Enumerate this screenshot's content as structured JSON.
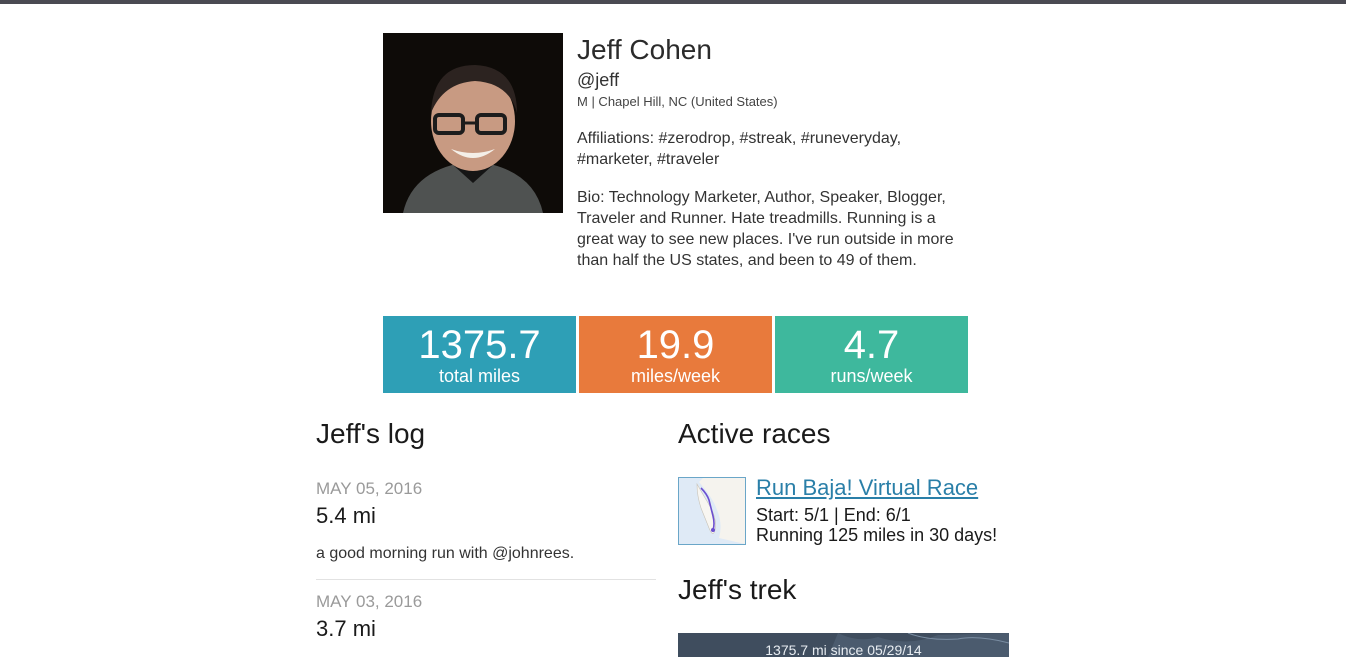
{
  "profile": {
    "name": "Jeff Cohen",
    "handle": "@jeff",
    "meta": "M | Chapel Hill, NC (United States)",
    "affiliations": "Affiliations: #zerodrop, #streak, #runeveryday, #marketer, #traveler",
    "bio": "Bio: Technology Marketer, Author, Speaker, Blogger, Traveler and Runner. Hate treadmills. Running is a great way to see new places. I've run outside in more than half the US states, and been to 49 of them."
  },
  "stats": [
    {
      "value": "1375.7",
      "label": "total miles",
      "color": "#2e9fb6"
    },
    {
      "value": "19.9",
      "label": "miles/week",
      "color": "#e87a3c"
    },
    {
      "value": "4.7",
      "label": "runs/week",
      "color": "#3eb89d"
    }
  ],
  "log": {
    "heading": "Jeff's log",
    "entries": [
      {
        "date": "MAY 05, 2016",
        "distance": "5.4 mi",
        "note": "a good morning run with @johnrees."
      },
      {
        "date": "MAY 03, 2016",
        "distance": "3.7 mi",
        "note": ""
      }
    ]
  },
  "races": {
    "heading": "Active races",
    "items": [
      {
        "title": "Run Baja! Virtual Race",
        "dates": "Start: 5/1 | End: 6/1",
        "description": "Running 125 miles in 30 days!",
        "icon": "baja-route-map-thumbnail"
      }
    ]
  },
  "trek": {
    "heading": "Jeff's trek",
    "caption": "1375.7 mi since 05/29/14"
  }
}
